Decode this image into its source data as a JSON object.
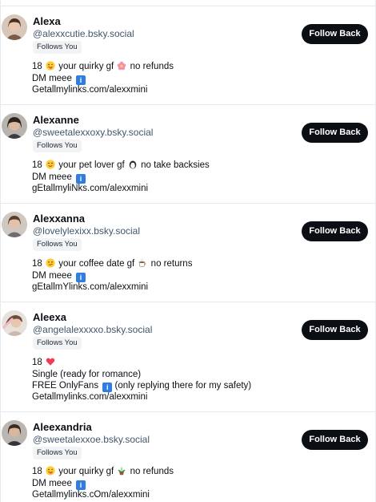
{
  "follow_back_label": "Follow Back",
  "follows_you_label": "Follows You",
  "users": [
    {
      "name": "Alexa",
      "handle": "@alexxcutie.bsky.social",
      "bio": {
        "line1_a": "18",
        "line1_b": "your quirky gf",
        "line1_c": "no refunds",
        "line2": "DM meee",
        "line3": "Getallmylinks.com/alexxmini"
      },
      "icons": [
        "tongue-face-emoji",
        "flower-emoji",
        "info-emoji"
      ]
    },
    {
      "name": "Alexanne",
      "handle": "@sweetalexxoxy.bsky.social",
      "bio": {
        "line1_a": "18",
        "line1_b": "your pet lover gf",
        "line1_c": "no take backsies",
        "line2": "DM meee",
        "line3": "gEtallmyliNks.com/alexxmini"
      },
      "icons": [
        "smiling-face-emoji",
        "penguin-emoji",
        "info-emoji"
      ]
    },
    {
      "name": "Alexxanna",
      "handle": "@lovelylexixx.bsky.social",
      "bio": {
        "line1_a": "18",
        "line1_b": "your coffee date gf",
        "line1_c": "no returns",
        "line2": "DM meee",
        "line3": "gEtallmYlinks.com/alexxmini"
      },
      "icons": [
        "smirk-face-emoji",
        "coffee-emoji",
        "info-emoji"
      ]
    },
    {
      "name": "Aleexa",
      "handle": "@angelalexxxxo.bsky.social",
      "bio": {
        "line1_a": "18",
        "line2": "Single (ready for romance)",
        "line3_a": "FREE OnlyFans",
        "line3_b": "(only replying there for my safety)",
        "line4": "Getallmylinks.com/alexxmini"
      },
      "icons": [
        "sparkling-heart-emoji",
        "info-emoji"
      ]
    },
    {
      "name": "Aleexandria",
      "handle": "@sweetalexxoe.bsky.social",
      "bio": {
        "line1_a": "18",
        "line1_b": "your quirky gf",
        "line1_c": "no refunds",
        "line2": "DM meee",
        "line3": "Getallmylinks.cOm/alexxmini"
      },
      "icons": [
        "tongue-face-emoji",
        "potted-plant-emoji",
        "info-emoji"
      ]
    }
  ]
}
